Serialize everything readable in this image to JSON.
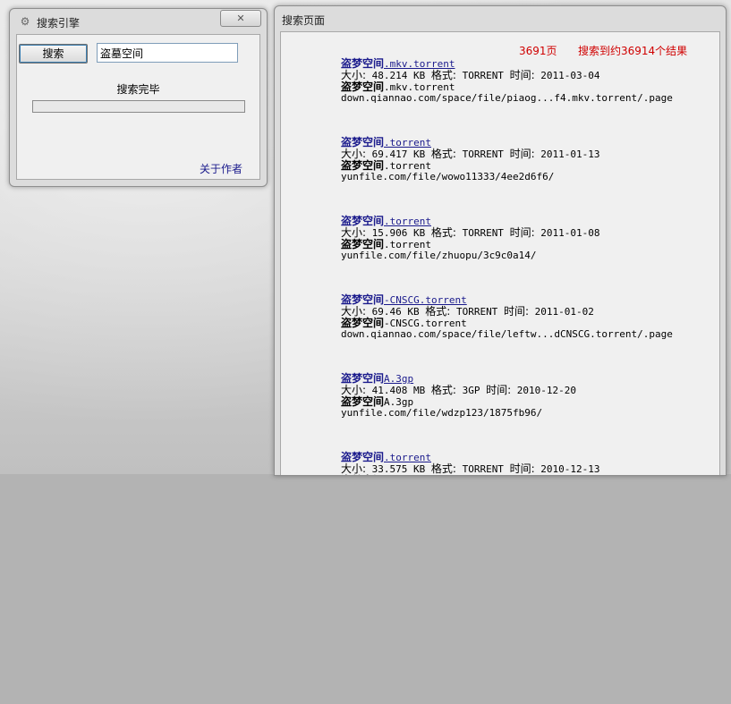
{
  "search_window": {
    "title": "搜索引擎",
    "close_glyph": "✕",
    "search_button_label": "搜索",
    "search_value": "盗墓空间",
    "status_text": "搜索完毕",
    "progress_fraction": 0,
    "about_link": "关于作者"
  },
  "results_window": {
    "title": "搜索页面",
    "page_count": "3691页",
    "result_count": "搜索到约36914个结果",
    "results": [
      {
        "keyword": "盗梦空间",
        "title_suffix": ".mkv.torrent",
        "size_label": "大小:",
        "size": " 48.214 KB ",
        "format_label": "格式:",
        "format": " TORRENT ",
        "time_label": "时间:",
        "time": " 2011-03-04",
        "name_suffix": ".mkv.torrent",
        "url": "down.qiannao.com/space/file/piaog...f4.mkv.torrent/.page"
      },
      {
        "keyword": "盗梦空间",
        "title_suffix": ".torrent",
        "size_label": "大小:",
        "size": " 69.417 KB ",
        "format_label": "格式:",
        "format": " TORRENT ",
        "time_label": "时间:",
        "time": " 2011-01-13",
        "name_suffix": ".torrent",
        "url": "yunfile.com/file/wowo11333/4ee2d6f6/"
      },
      {
        "keyword": "盗梦空间",
        "title_suffix": ".torrent",
        "size_label": "大小:",
        "size": " 15.906 KB ",
        "format_label": "格式:",
        "format": " TORRENT ",
        "time_label": "时间:",
        "time": " 2011-01-08",
        "name_suffix": ".torrent",
        "url": "yunfile.com/file/zhuopu/3c9c0a14/"
      },
      {
        "keyword": "盗梦空间",
        "title_suffix": "-CNSCG.torrent",
        "size_label": "大小:",
        "size": " 69.46 KB ",
        "format_label": "格式:",
        "format": " TORRENT ",
        "time_label": "时间:",
        "time": " 2011-01-02",
        "name_suffix": "-CNSCG.torrent",
        "url": "down.qiannao.com/space/file/leftw...dCNSCG.torrent/.page"
      },
      {
        "keyword": "盗梦空间",
        "title_suffix": "A.3gp",
        "size_label": "大小:",
        "size": " 41.408 MB ",
        "format_label": "格式:",
        "format": " 3GP ",
        "time_label": "时间:",
        "time": " 2010-12-20",
        "name_suffix": "A.3gp",
        "url": "yunfile.com/file/wdzp123/1875fb96/"
      },
      {
        "keyword": "盗梦空间",
        "title_suffix": ".torrent",
        "size_label": "大小:",
        "size": " 33.575 KB ",
        "format_label": "格式:",
        "format": " TORRENT ",
        "time_label": "时间:",
        "time": " 2010-12-13",
        "name_suffix": ".torrent",
        "url": ""
      }
    ]
  }
}
